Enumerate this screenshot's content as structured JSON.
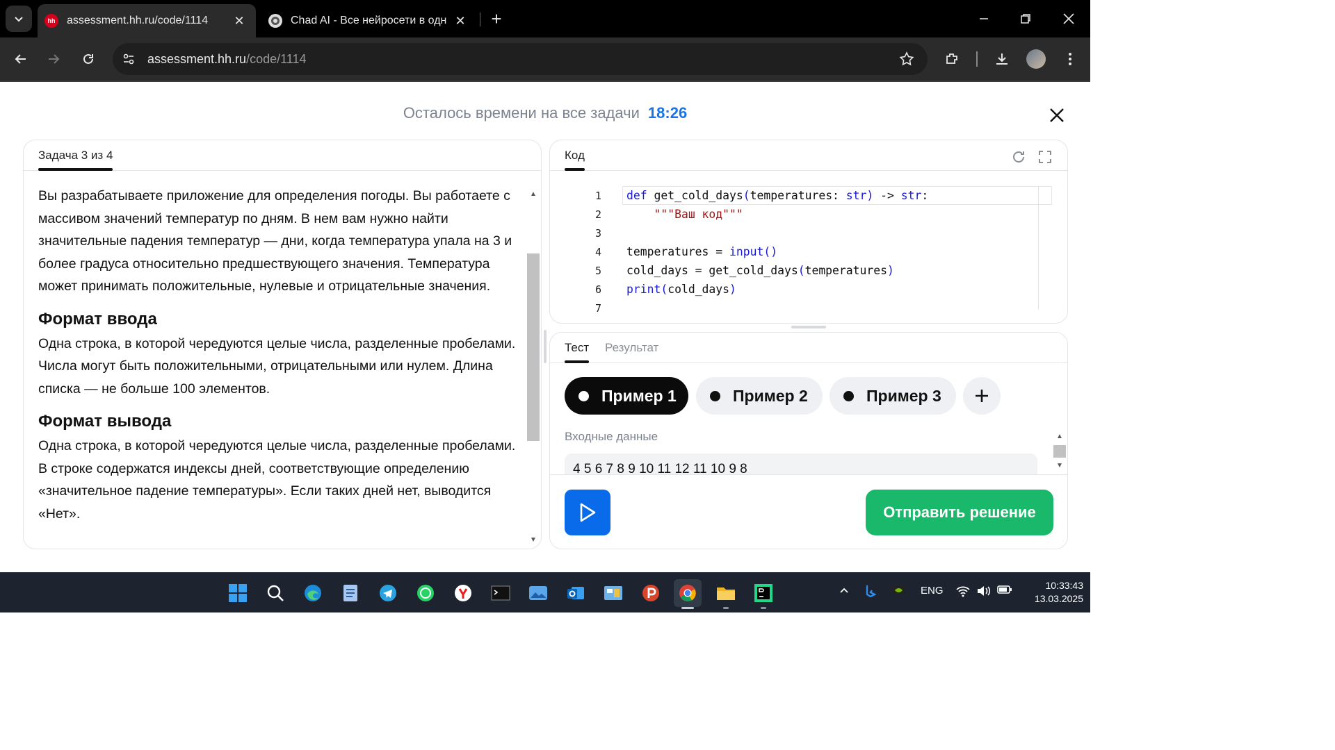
{
  "browser": {
    "tabs": [
      {
        "title": "assessment.hh.ru/code/1114",
        "favicon": "hh",
        "active": true
      },
      {
        "title": "Chad AI - Все нейросети в одн",
        "favicon": "chad-ai",
        "active": false
      }
    ],
    "url_host": "assessment.hh.ru",
    "url_path": "/code/1114"
  },
  "header": {
    "timer_label": "Осталось времени на все задачи",
    "timer_value": "18:26"
  },
  "task": {
    "tab_label": "Задача 3 из 4",
    "description": "Вы разрабатываете приложение для определения погоды. Вы работаете с массивом значений температур по дням. В нем вам нужно найти значительные падения температур — дни, когда температура упала на 3 и более градуса относительно предшествующего значения. Температура может принимать положительные, нулевые и отрицательные значения.",
    "input_heading": "Формат ввода",
    "input_text": "Одна строка, в которой чередуются целые числа, разделенные пробелами. Числа могут быть положительными, отрицательными или нулем. Длина списка — не больше 100 элементов.",
    "output_heading": "Формат вывода",
    "output_text": "Одна строка, в которой чередуются целые числа, разделенные пробелами. В строке содержатся индексы дней, соответствующие определению «значительное падение температуры». Если таких дней нет, выводится «Нет»."
  },
  "code_panel": {
    "tab_label": "Код",
    "line_numbers": [
      "1",
      "2",
      "3",
      "4",
      "5",
      "6",
      "7"
    ]
  },
  "test_panel": {
    "tabs": [
      "Тест",
      "Результат"
    ],
    "examples": [
      "Пример 1",
      "Пример 2",
      "Пример 3"
    ],
    "input_label": "Входные данные",
    "input_value": "4 5 6 7 8 9 10 11 12 11 10 9 8",
    "submit_label": "Отправить решение"
  },
  "taskbar": {
    "apps": [
      "windows-start",
      "search",
      "edge",
      "notepad",
      "telegram",
      "whatsapp",
      "yandex-browser",
      "terminal",
      "photos",
      "outlook",
      "control-panel",
      "app-p",
      "chrome",
      "file-explorer",
      "pycharm"
    ],
    "tray_lang": "ENG",
    "time": "10:33:43",
    "date": "13.03.2025"
  },
  "colors": {
    "accent_blue": "#1a73e8",
    "run_button": "#0a6bea",
    "submit_button": "#19b86a",
    "hh_red": "#d6001c"
  }
}
